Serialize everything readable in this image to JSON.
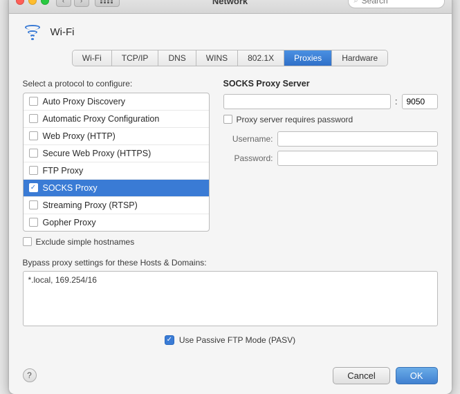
{
  "window": {
    "title": "Network"
  },
  "titlebar": {
    "back_label": "‹",
    "forward_label": "›",
    "search_placeholder": "Search"
  },
  "wifi_header": {
    "label": "Wi-Fi"
  },
  "tabs": [
    {
      "id": "wifi",
      "label": "Wi-Fi",
      "active": false
    },
    {
      "id": "tcpip",
      "label": "TCP/IP",
      "active": false
    },
    {
      "id": "dns",
      "label": "DNS",
      "active": false
    },
    {
      "id": "wins",
      "label": "WINS",
      "active": false
    },
    {
      "id": "8021x",
      "label": "802.1X",
      "active": false
    },
    {
      "id": "proxies",
      "label": "Proxies",
      "active": true
    },
    {
      "id": "hardware",
      "label": "Hardware",
      "active": false
    }
  ],
  "left_panel": {
    "label": "Select a protocol to configure:",
    "items": [
      {
        "id": "auto-proxy-discovery",
        "label": "Auto Proxy Discovery",
        "checked": false,
        "selected": false
      },
      {
        "id": "automatic-proxy",
        "label": "Automatic Proxy Configuration",
        "checked": false,
        "selected": false
      },
      {
        "id": "web-proxy-http",
        "label": "Web Proxy (HTTP)",
        "checked": false,
        "selected": false
      },
      {
        "id": "secure-web-proxy",
        "label": "Secure Web Proxy (HTTPS)",
        "checked": false,
        "selected": false
      },
      {
        "id": "ftp-proxy",
        "label": "FTP Proxy",
        "checked": false,
        "selected": false
      },
      {
        "id": "socks-proxy",
        "label": "SOCKS Proxy",
        "checked": true,
        "selected": true
      },
      {
        "id": "streaming-proxy",
        "label": "Streaming Proxy (RTSP)",
        "checked": false,
        "selected": false
      },
      {
        "id": "gopher-proxy",
        "label": "Gopher Proxy",
        "checked": false,
        "selected": false
      }
    ],
    "exclude_label": "Exclude simple hostnames"
  },
  "right_panel": {
    "section_title": "SOCKS Proxy Server",
    "host_placeholder": "",
    "port_value": "9050",
    "requires_password_label": "Proxy server requires password",
    "username_label": "Username:",
    "password_label": "Password:"
  },
  "bypass_section": {
    "label": "Bypass proxy settings for these Hosts & Domains:",
    "value": "*.local, 169.254/16"
  },
  "pasv": {
    "label": "Use Passive FTP Mode (PASV)",
    "checked": true
  },
  "footer": {
    "help_label": "?",
    "cancel_label": "Cancel",
    "ok_label": "OK"
  }
}
